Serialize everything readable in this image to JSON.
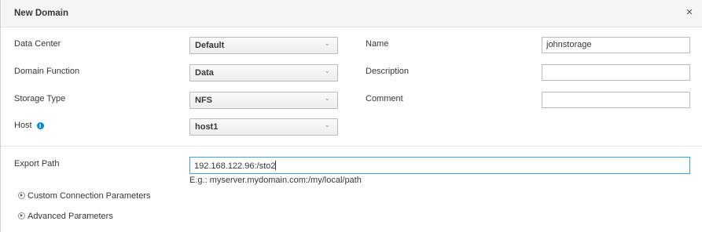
{
  "dialog": {
    "title": "New Domain",
    "close_glyph": "×"
  },
  "left": {
    "data_center": {
      "label": "Data Center",
      "value": "Default"
    },
    "domain_function": {
      "label": "Domain Function",
      "value": "Data"
    },
    "storage_type": {
      "label": "Storage Type",
      "value": "NFS"
    },
    "host": {
      "label": "Host",
      "value": "host1",
      "icon": "info-icon"
    }
  },
  "right": {
    "name": {
      "label": "Name",
      "value": "johnstorage"
    },
    "description": {
      "label": "Description",
      "value": ""
    },
    "comment": {
      "label": "Comment",
      "value": ""
    }
  },
  "export": {
    "label": "Export Path",
    "value": "192.168.122.96:/sto2",
    "help": "E.g.: myserver.mydomain.com:/my/local/path"
  },
  "sections": {
    "custom_connection": "Custom Connection Parameters",
    "advanced": "Advanced Parameters"
  },
  "icons": {
    "chevron": "chevron-down-icon",
    "expander": "chevron-right-circle-icon"
  },
  "colors": {
    "focus_border": "#39a5dc",
    "info_blue": "#0088ce"
  }
}
